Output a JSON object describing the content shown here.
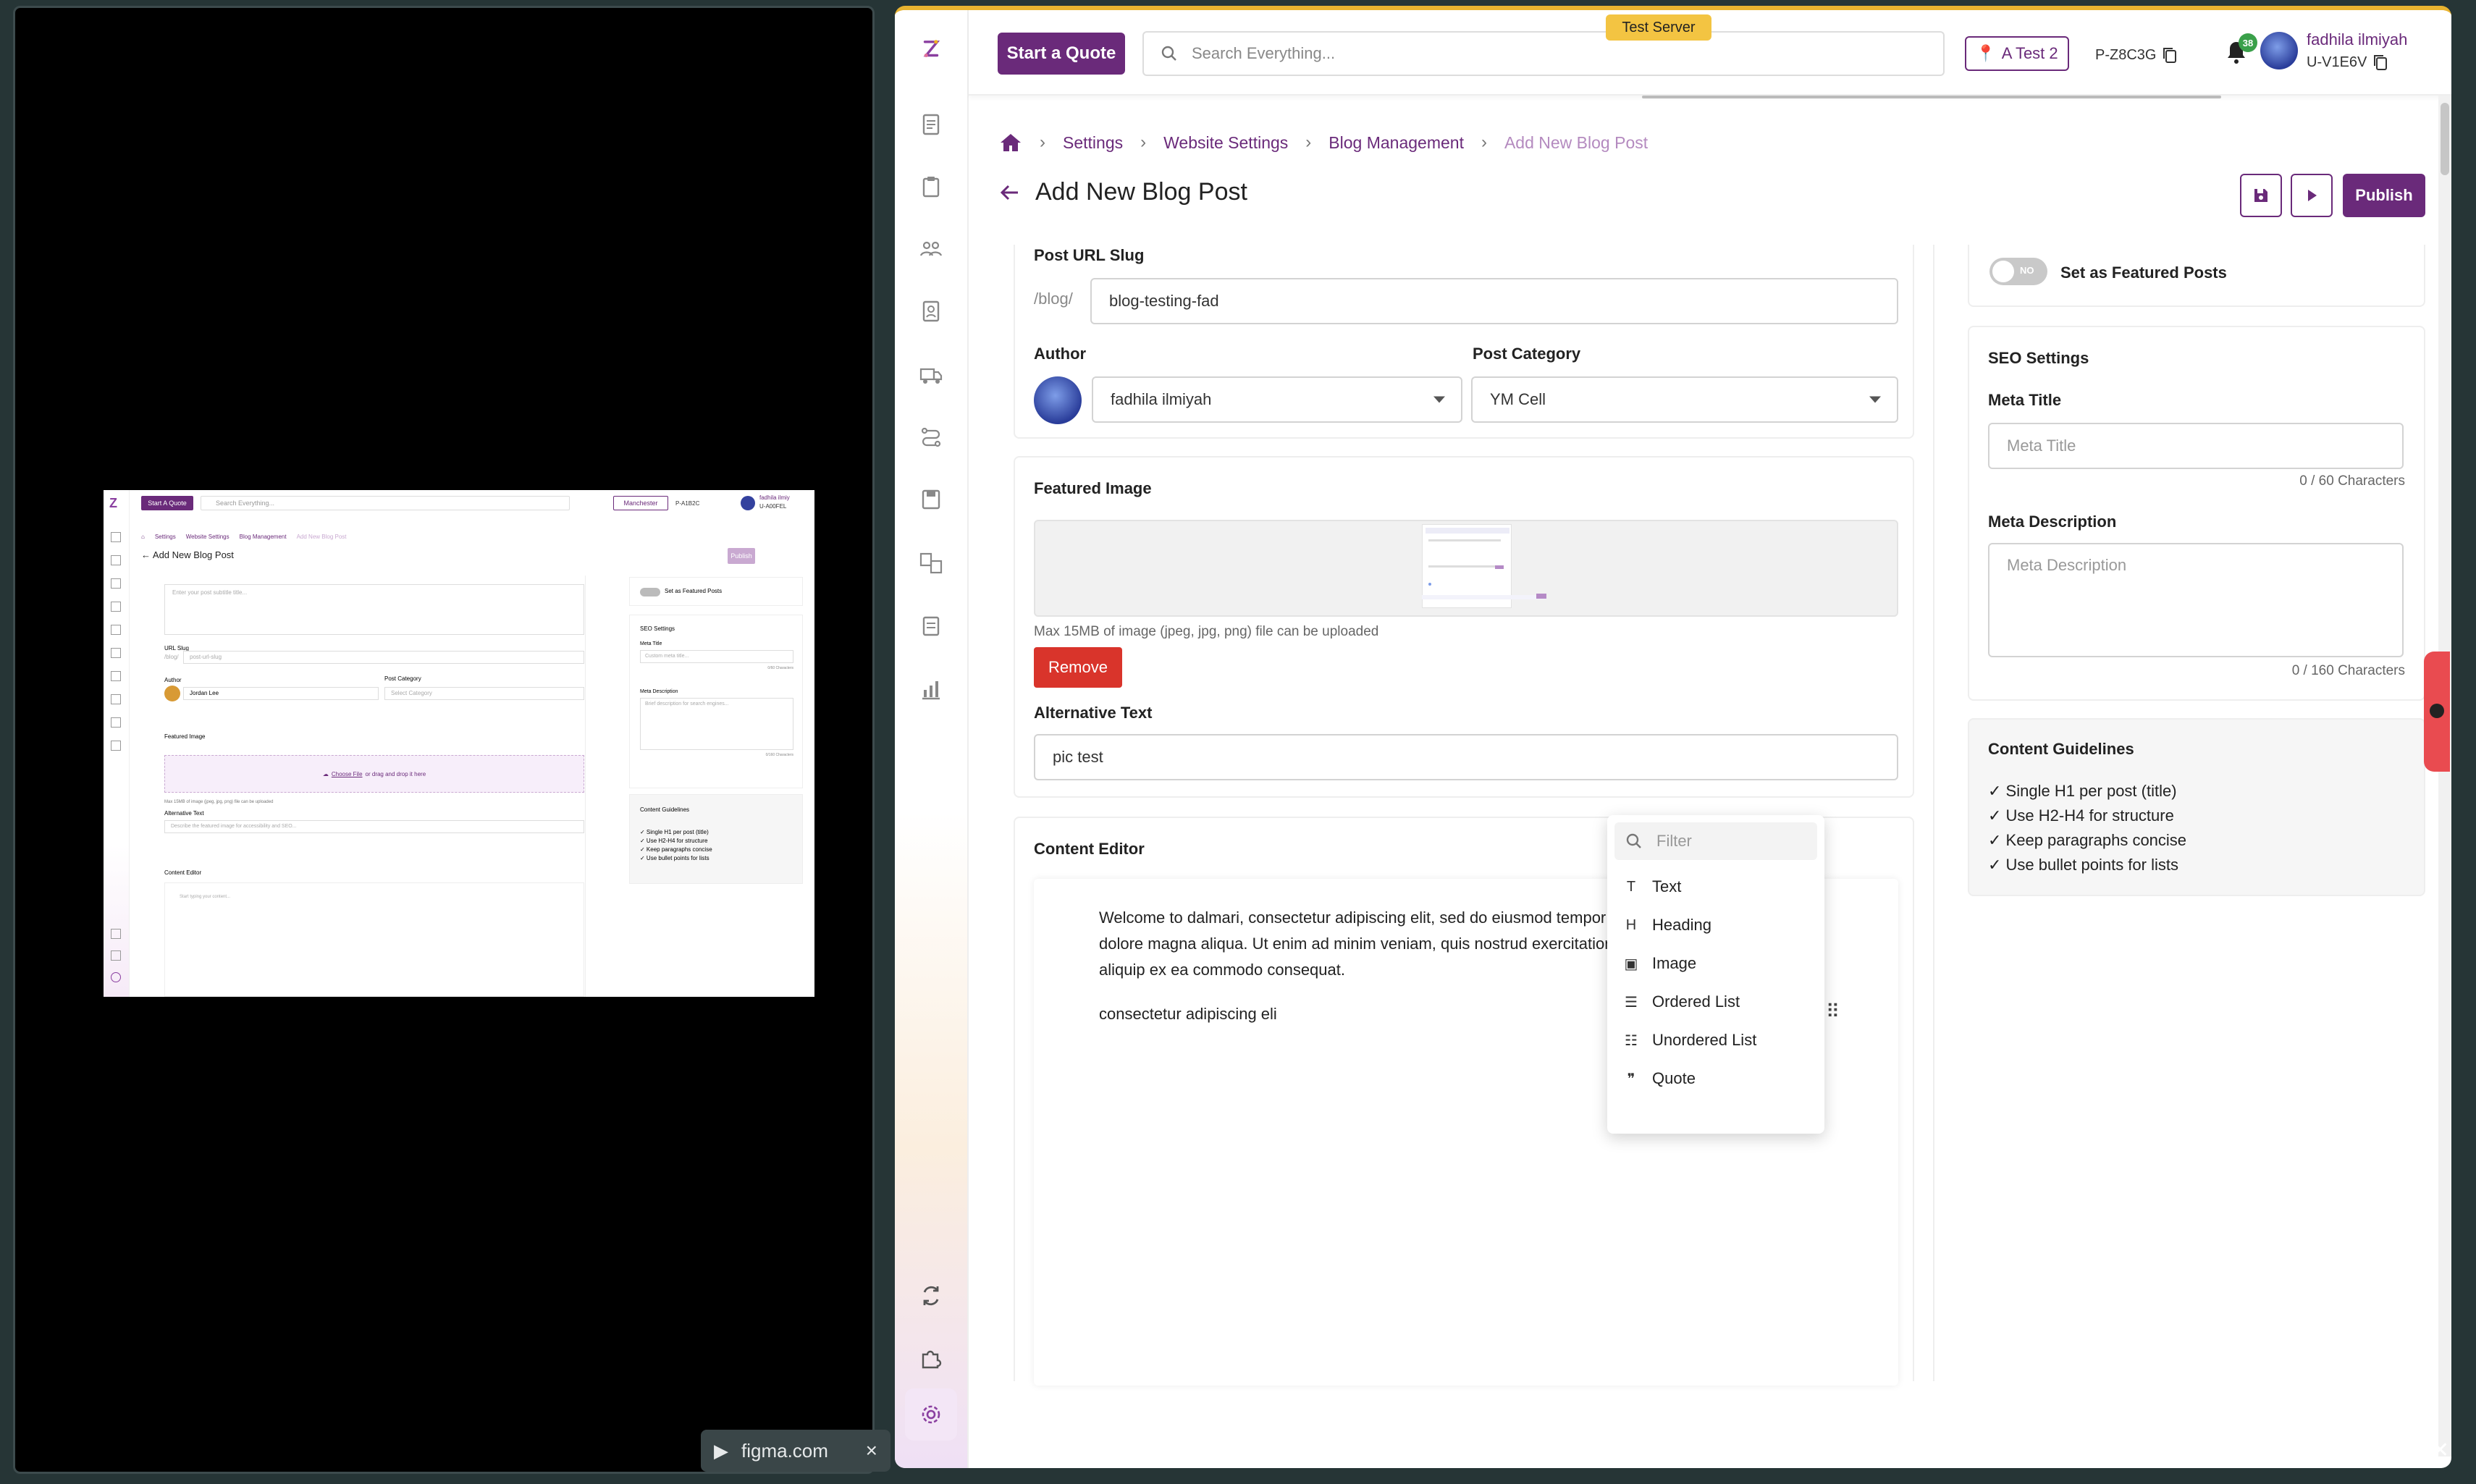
{
  "share_tab": {
    "label": "figma.com",
    "close": "×"
  },
  "mini": {
    "quote_btn": "Start A Quote",
    "search_ph": "Search Everything...",
    "location": "Manchester",
    "pcode": "P-A1B2C",
    "user_name": "fadhila ilmiy",
    "user_id": "U-A00FEL",
    "crumbs": [
      "Settings",
      "Website Settings",
      "Blog Management",
      "Add New Blog Post"
    ],
    "title": "Add New Blog Post",
    "publish": "Publish",
    "subtitle_ph": "Enter your post subtitle title...",
    "url_slug_label": "URL Slug",
    "url_prefix": "/blog/",
    "url_ph": "post-url-slug",
    "author_label": "Author",
    "author_value": "Jordan Lee",
    "category_label": "Post Category",
    "category_ph": "Select Category",
    "featured_label": "Featured Image",
    "choose_file": "Choose File",
    "drag_drop": "or drag and drop it here",
    "max_note": "Max 15MB of image (jpeg, jpg, png) file can be uploaded",
    "alt_label": "Alternative Text",
    "alt_ph": "Describe the featured image for accessibility and SEO...",
    "content_label": "Content Editor",
    "content_ph": "Start typing your content...",
    "featured_toggle": "Set as Featured Posts",
    "seo_title": "SEO Settings",
    "meta_title": "Meta Title",
    "meta_title_ph": "Custom meta title...",
    "meta_count": "0/60 Characters",
    "meta_desc": "Meta Description",
    "meta_desc_ph": "Brief description for search engines...",
    "meta_desc_count": "0/160 Characters",
    "guidelines_title": "Content Guidelines",
    "guidelines": [
      "✓ Single H1 per post (title)",
      "✓ Use H2-H4 for structure",
      "✓ Keep paragraphs concise",
      "✓ Use bullet points for lists"
    ]
  },
  "topbar": {
    "quote_btn": "Start a Quote",
    "search_placeholder": "Search Everything...",
    "test_server": "Test Server",
    "location": "A Test 2",
    "pcode": "P-Z8C3G",
    "notif_count": "38",
    "user_name": "fadhila ilmiyah",
    "user_id": "U-V1E6V"
  },
  "breadcrumb": {
    "items": [
      "Settings",
      "Website Settings",
      "Blog Management"
    ],
    "current": "Add New Blog Post"
  },
  "page": {
    "title": "Add New Blog Post",
    "publish": "Publish"
  },
  "form": {
    "slug_label": "Post URL Slug",
    "slug_prefix": "/blog/",
    "slug_value": "blog-testing-fad",
    "author_label": "Author",
    "author_value": "fadhila ilmiyah",
    "category_label": "Post Category",
    "category_value": "YM Cell",
    "featured_label": "Featured Image",
    "upload_note": "Max 15MB of image (jpeg, jpg, png) file can be uploaded",
    "remove_btn": "Remove",
    "alt_label": "Alternative Text",
    "alt_value": "pic test",
    "editor_label": "Content Editor",
    "paragraph": "Welcome to dalmari, consectetur adipiscing elit, sed do eiusmod tempor incididunt ut labore et dolore magna aliqua. Ut enim ad minim veniam, quis nostrud exercitation ullamco laboris nisi ut aliquip ex ea commodo consequat.",
    "line2": "consectetur adipiscing eli"
  },
  "block_menu": {
    "filter_placeholder": "Filter",
    "items": [
      {
        "label": "Text",
        "icon": "T"
      },
      {
        "label": "Heading",
        "icon": "H"
      },
      {
        "label": "Image",
        "icon": "▣"
      },
      {
        "label": "Ordered List",
        "icon": "☰"
      },
      {
        "label": "Unordered List",
        "icon": "☷"
      },
      {
        "label": "Quote",
        "icon": "❞"
      }
    ]
  },
  "right_panel": {
    "toggle_text": "NO",
    "featured_toggle_label": "Set as Featured Posts",
    "seo_title": "SEO Settings",
    "meta_title_label": "Meta Title",
    "meta_title_placeholder": "Meta Title",
    "meta_title_count": "0 / 60 Characters",
    "meta_desc_label": "Meta Description",
    "meta_desc_placeholder": "Meta Description",
    "meta_desc_count": "0 / 160 Characters",
    "guidelines_title": "Content Guidelines",
    "guidelines": [
      "✓ Single H1 per post (title)",
      "✓ Use H2-H4 for structure",
      "✓ Keep paragraphs concise",
      "✓ Use bullet points for lists"
    ]
  },
  "colors": {
    "brand": "#6a2a7a",
    "danger": "#d9342b",
    "accent": "#f3c442"
  }
}
